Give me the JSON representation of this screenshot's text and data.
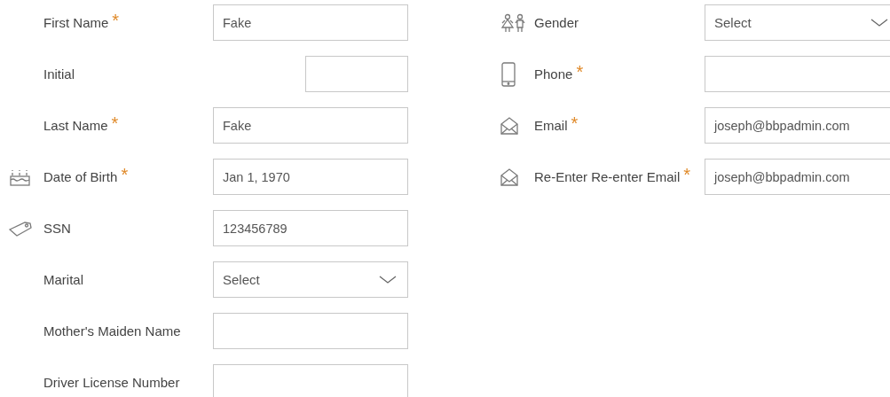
{
  "columns": [
    {
      "fields": [
        {
          "label": "First Name",
          "required_mark": "*",
          "kind": "text",
          "value": "Fake"
        },
        {
          "label": "Initial",
          "kind": "short"
        },
        {
          "label": "Last Name",
          "required_mark": "*",
          "kind": "text",
          "value": "Fake"
        },
        {
          "label": "Date of Birth",
          "required_mark": "*",
          "kind": "text",
          "value": "Jan 1, 1970"
        },
        {
          "label": "SSN",
          "kind": "text",
          "value": "123456789"
        },
        {
          "label": "Marital",
          "kind": "select",
          "value": "Select"
        },
        {
          "label": "Mother's Maiden Name",
          "kind": "text"
        },
        {
          "label": "Driver License Number",
          "kind": "text"
        }
      ]
    },
    {
      "fields": [
        {
          "label": "Gender",
          "kind": "select",
          "value": "Select"
        },
        {
          "label": "Phone",
          "required_mark": "*",
          "kind": "text"
        },
        {
          "label": "Email",
          "required_mark": "*",
          "kind": "text",
          "value": "joseph@bbpadmin.com"
        },
        {
          "label": "Re-Enter Re-enter Email",
          "required_mark": "*",
          "kind": "text",
          "value": "joseph@bbpadmin.com"
        }
      ]
    }
  ]
}
